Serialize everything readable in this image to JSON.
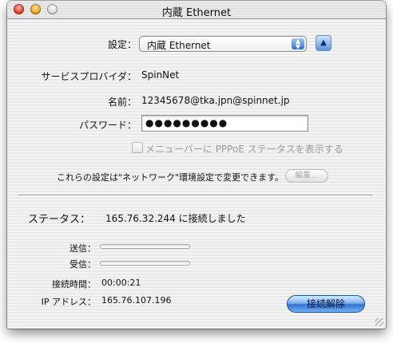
{
  "window": {
    "title": "内蔵 Ethernet"
  },
  "config": {
    "label": "設定：",
    "selected": "内蔵 Ethernet"
  },
  "provider": {
    "label": "サービスプロバイダ：",
    "value": "SpinNet"
  },
  "account": {
    "label": "名前：",
    "value": "12345678@tka.jpn@spinnet.jp"
  },
  "password": {
    "label": "パスワード：",
    "value": "●●●●●●●●●"
  },
  "menubar_checkbox": {
    "label": "メニューバーに PPPoE ステータスを表示する",
    "checked": false
  },
  "note": {
    "text": "これらの設定は\"ネットワーク\"環境設定で変更できます。"
  },
  "edit_button": {
    "label": "編集..."
  },
  "status": {
    "label": "ステータス：",
    "value": "165.76.32.244 に接続しました",
    "send_label": "送信：",
    "send_progress": 0,
    "recv_label": "受信：",
    "recv_progress": 0,
    "time_label": "接続時間：",
    "time_value": "00:00:21",
    "ip_label": "IP アドレス：",
    "ip_value": "165.76.107.196"
  },
  "disconnect_button": {
    "label": "接続解除"
  },
  "icons": {
    "close": "close-icon",
    "minimize": "minimize-icon",
    "zoom": "zoom-icon",
    "popup_arrows": "up-down-arrows-icon",
    "eject": "eject-icon"
  }
}
